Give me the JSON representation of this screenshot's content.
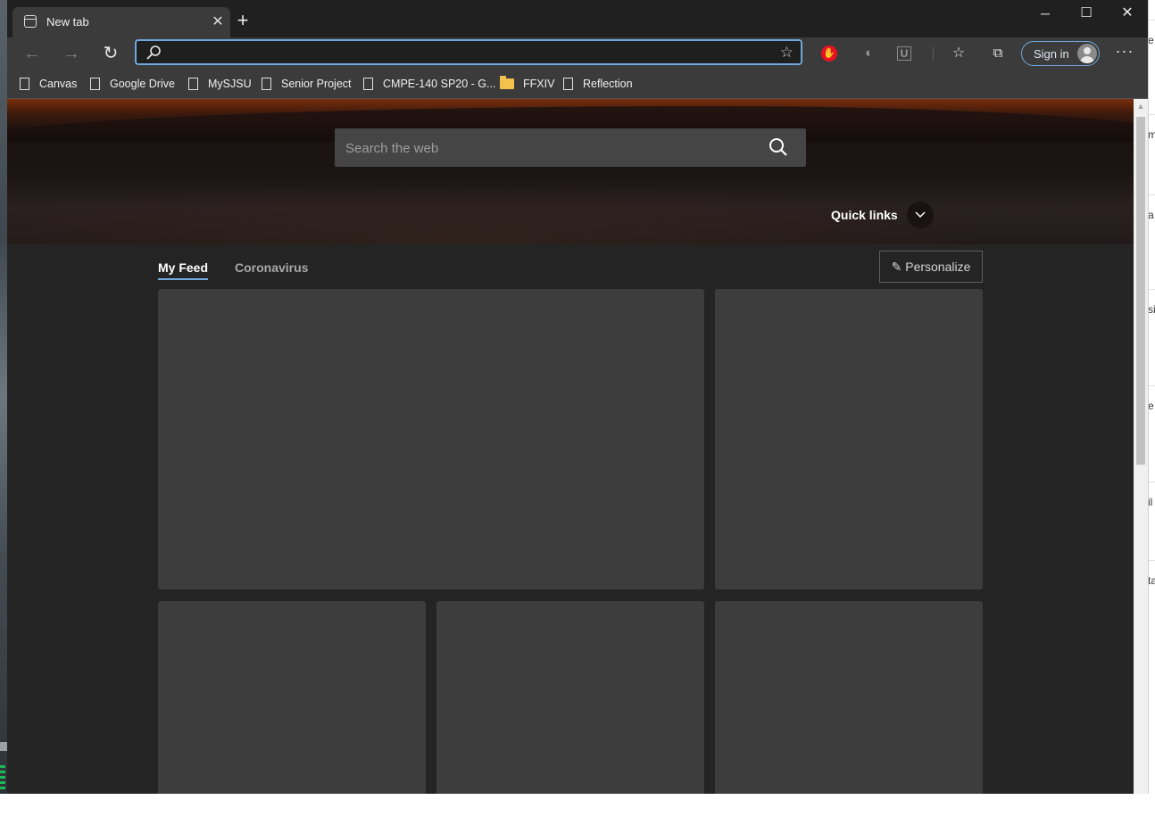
{
  "window": {
    "tab_title": "New tab",
    "new_tab_symbol": "+",
    "minimize_symbol": "─",
    "maximize_symbol": "☐",
    "close_symbol": "✕"
  },
  "toolbar": {
    "address_value": "",
    "sign_in_label": "Sign in",
    "more_symbol": "···"
  },
  "favorites": [
    {
      "label": "Canvas",
      "icon": "page-icon"
    },
    {
      "label": "Google Drive",
      "icon": "page-icon"
    },
    {
      "label": "MySJSU",
      "icon": "page-icon"
    },
    {
      "label": "Senior Project",
      "icon": "page-icon"
    },
    {
      "label": "CMPE-140 SP20 - G...",
      "icon": "page-icon"
    },
    {
      "label": "FFXIV",
      "icon": "folder-icon"
    },
    {
      "label": "Reflection",
      "icon": "page-icon"
    }
  ],
  "newtab": {
    "search_placeholder": "Search the web",
    "quick_links_label": "Quick links",
    "feed_tabs": [
      "My Feed",
      "Coronavirus"
    ],
    "personalize_label": "Personalize"
  },
  "colors": {
    "accent": "#6fa8dc",
    "card": "#3d3d3d",
    "background": "#242424"
  },
  "background_window_fragments": [
    "e",
    "m",
    "a",
    "si",
    "e",
    "il",
    "ta"
  ]
}
